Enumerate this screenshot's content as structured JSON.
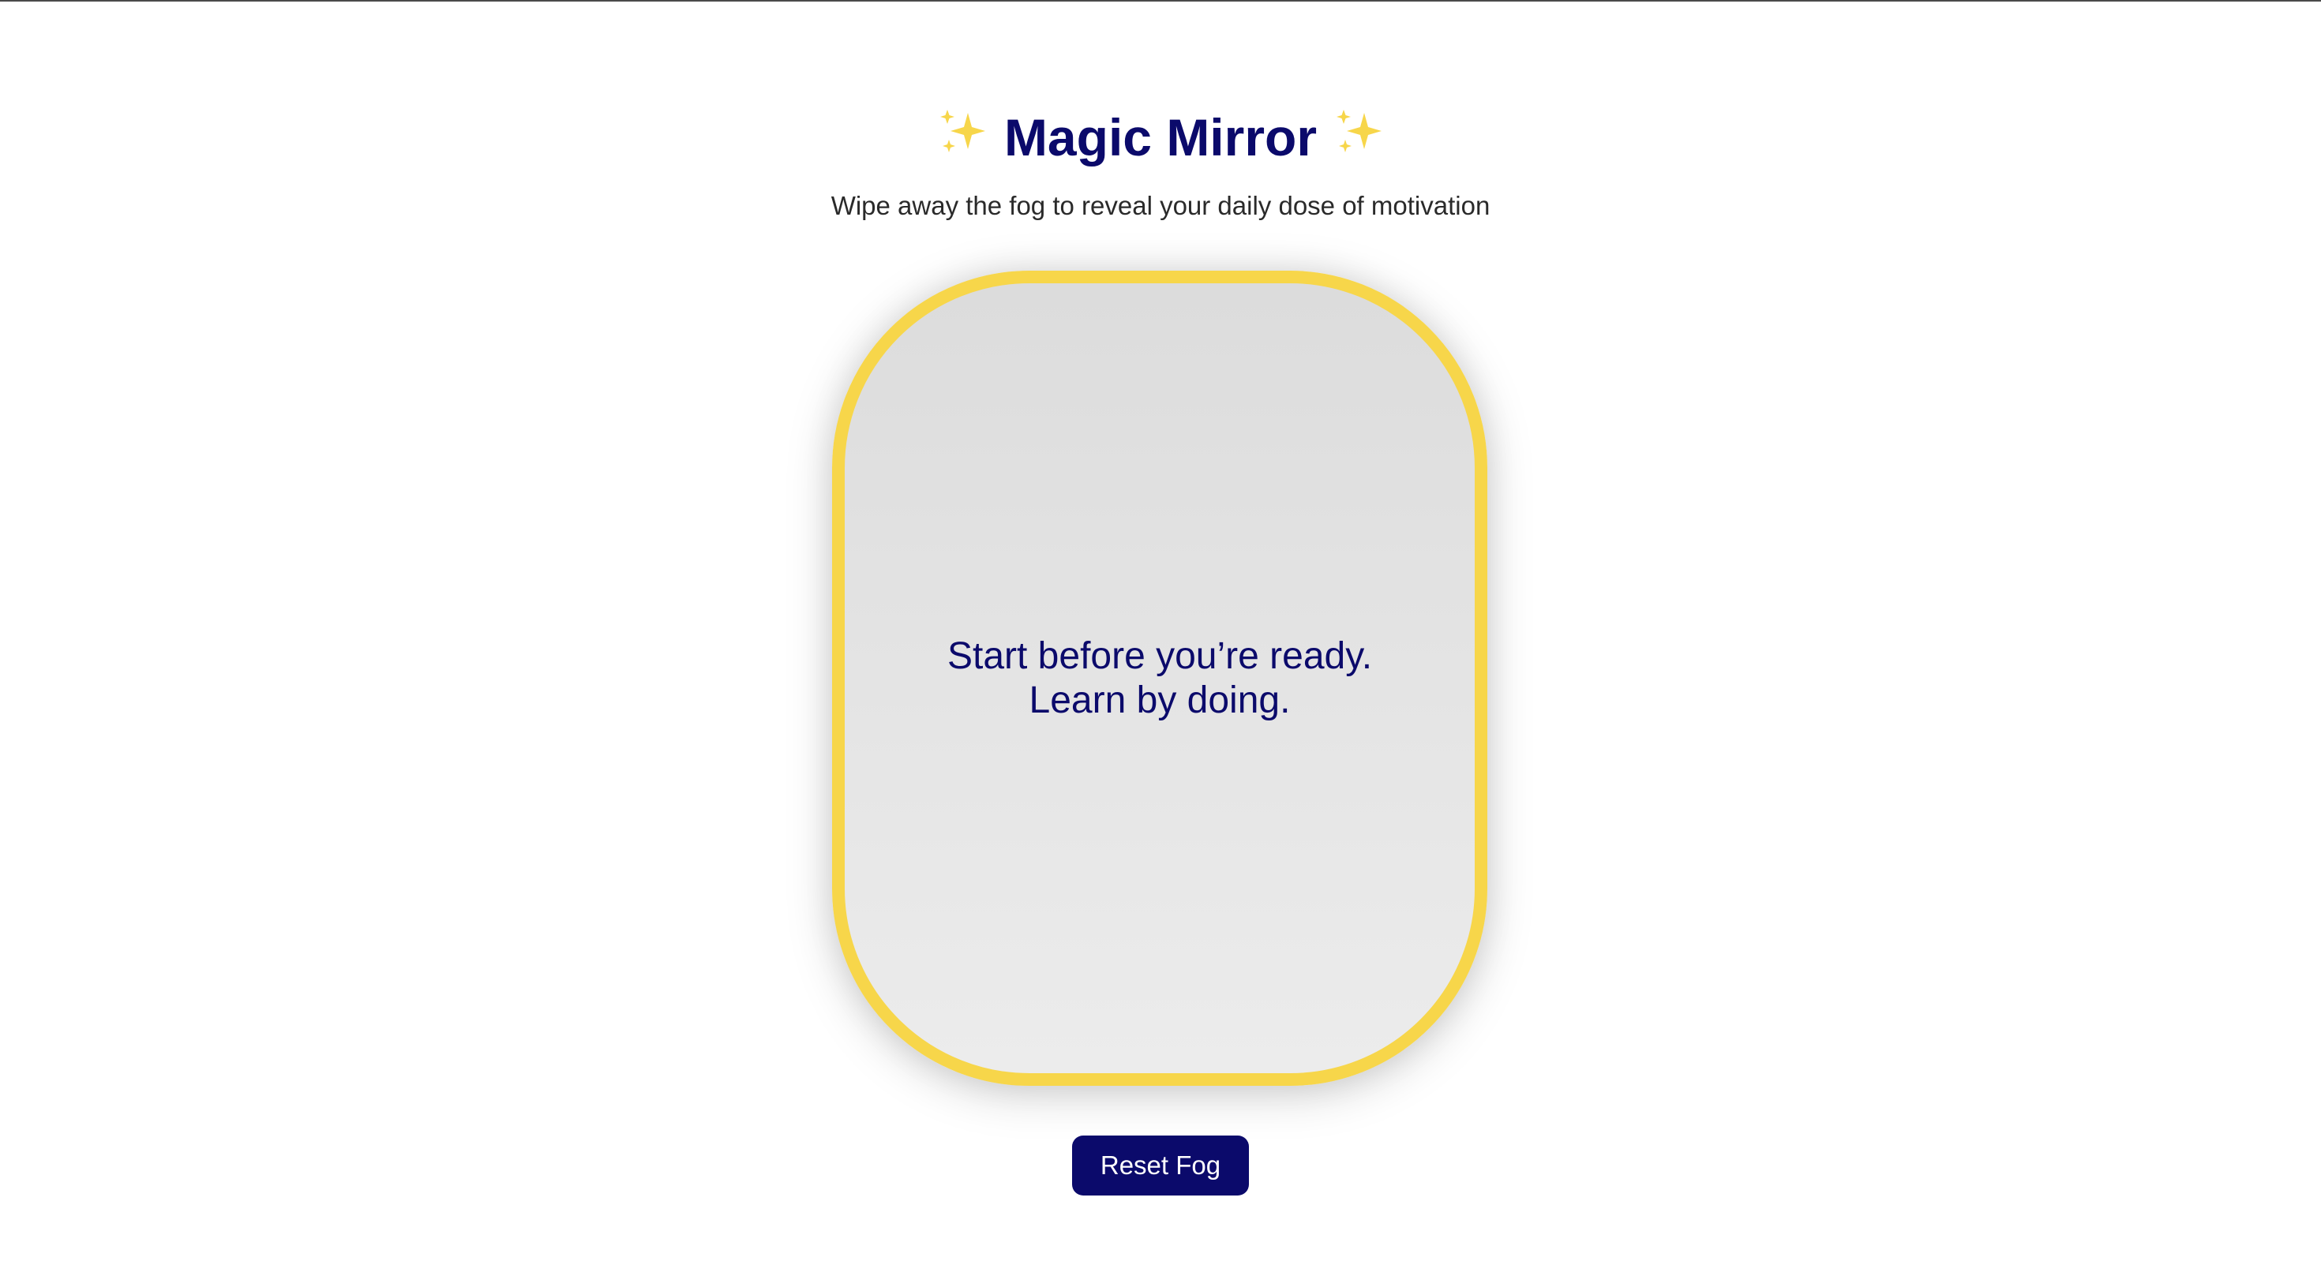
{
  "header": {
    "title": "Magic Mirror",
    "left_icon": "sparkles-icon",
    "right_icon": "sparkles-icon",
    "subtitle": "Wipe away the fog to reveal your daily dose of motivation"
  },
  "mirror": {
    "quote_line_1": "Start before you’re ready.",
    "quote_line_2": "Learn by doing."
  },
  "controls": {
    "reset_label": "Reset Fog"
  },
  "colors": {
    "primary": "#0b0a6b",
    "frame": "#f7d64a",
    "fog": "#e2e2e2",
    "sparkle": "#f7d64a"
  }
}
